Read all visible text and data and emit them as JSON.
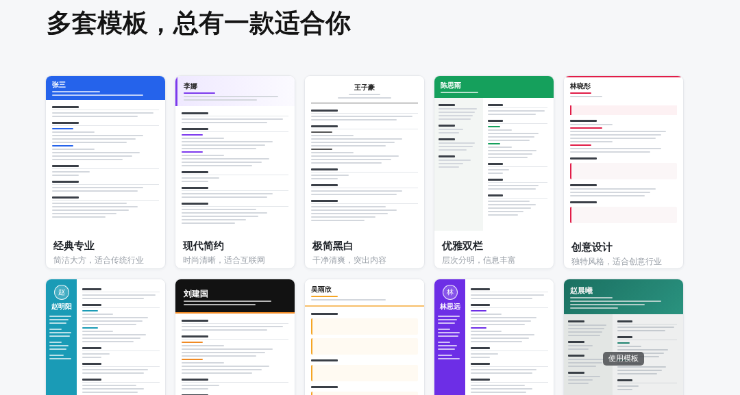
{
  "heading": "多套模板，总有一款适合你",
  "hover_button": {
    "label": "使用模板"
  },
  "templates": [
    {
      "kind": "classic",
      "resume_name": "张三",
      "title": "经典专业",
      "description": "简洁大方，适合传统行业",
      "hovered": false
    },
    {
      "kind": "modern",
      "resume_name": "李娜",
      "title": "现代简约",
      "description": "时尚清晰，适合互联网",
      "hovered": false
    },
    {
      "kind": "minimal",
      "resume_name": "王子豪",
      "title": "极简黑白",
      "description": "干净清爽，突出内容",
      "hovered": false
    },
    {
      "kind": "twocolumn",
      "resume_name": "陈思雨",
      "title": "优雅双栏",
      "description": "层次分明，信息丰富",
      "hovered": false
    },
    {
      "kind": "creative",
      "resume_name": "林晓彤",
      "title": "创意设计",
      "description": "独特风格，适合创意行业",
      "hovered": false
    },
    {
      "kind": "sidebar",
      "avatar": "赵",
      "resume_name": "赵明阳",
      "hovered": false
    },
    {
      "kind": "dark",
      "resume_name": "刘建国",
      "hovered": false
    },
    {
      "kind": "accent",
      "resume_name": "吴雨欣",
      "hovered": false
    },
    {
      "kind": "violet",
      "avatar": "林",
      "resume_name": "林思远",
      "hovered": false
    },
    {
      "kind": "banner",
      "resume_name": "赵晨曦",
      "hovered": true
    }
  ]
}
